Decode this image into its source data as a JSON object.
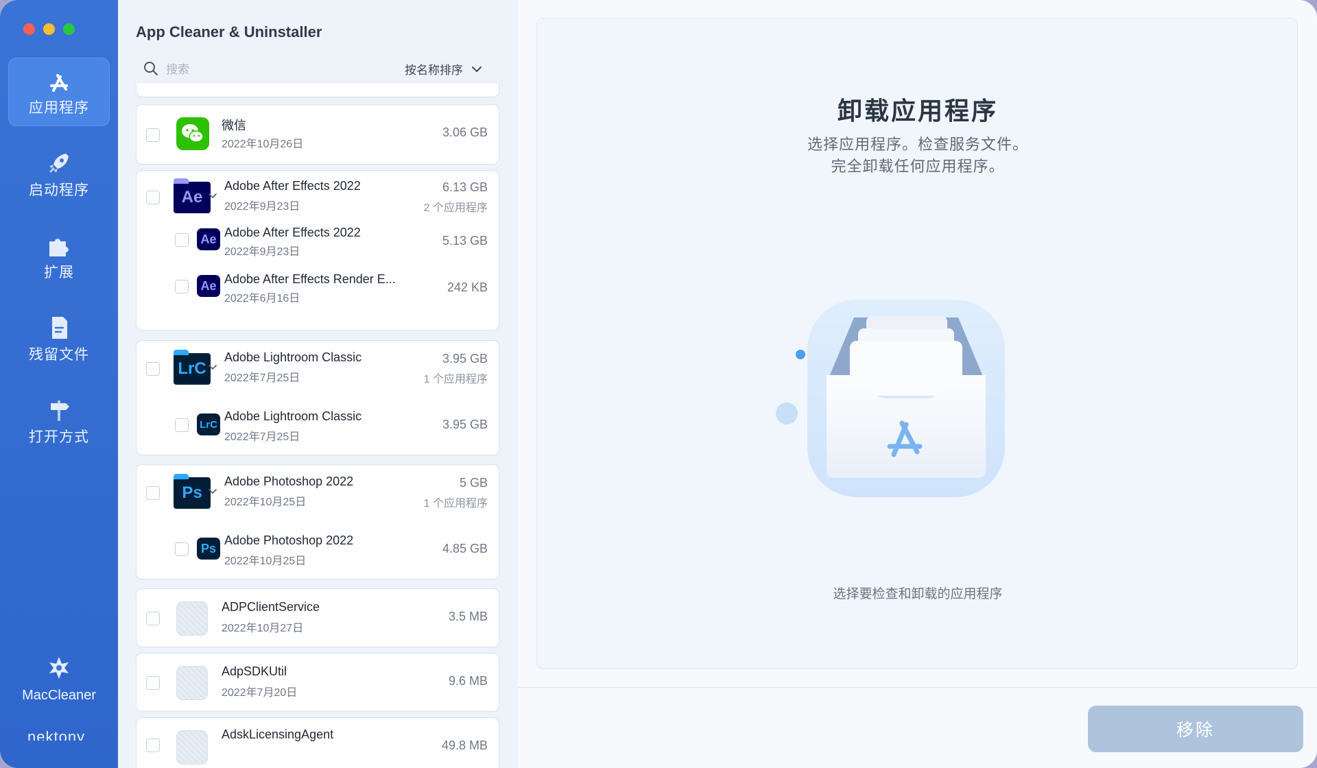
{
  "app": {
    "title": "App Cleaner & Uninstaller"
  },
  "sidebar": {
    "items": [
      {
        "label": "应用程序",
        "icon": "app-store-icon"
      },
      {
        "label": "启动程序",
        "icon": "rocket-icon"
      },
      {
        "label": "扩展",
        "icon": "puzzle-icon"
      },
      {
        "label": "残留文件",
        "icon": "document-icon"
      },
      {
        "label": "打开方式",
        "icon": "signpost-icon"
      }
    ],
    "bottom": {
      "label": "MacCleaner",
      "icon": "maccleaner-icon"
    },
    "brand": "nektony"
  },
  "search": {
    "placeholder": "搜索",
    "value": ""
  },
  "sort": {
    "label": "按名称排序"
  },
  "apps": [
    {
      "name": "微信",
      "date": "2022年10月26日",
      "size": "3.06 GB"
    },
    {
      "name": "Adobe After Effects 2022",
      "date": "2022年9月23日",
      "size": "6.13 GB",
      "count": "2 个应用程序",
      "children": [
        {
          "name": "Adobe After Effects 2022",
          "date": "2022年9月23日",
          "size": "5.13 GB"
        },
        {
          "name": "Adobe After Effects Render E...",
          "date": "2022年6月16日",
          "size": "242 KB"
        }
      ]
    },
    {
      "name": "Adobe Lightroom Classic",
      "date": "2022年7月25日",
      "size": "3.95 GB",
      "count": "1 个应用程序",
      "children": [
        {
          "name": "Adobe Lightroom Classic",
          "date": "2022年7月25日",
          "size": "3.95 GB"
        }
      ]
    },
    {
      "name": "Adobe Photoshop 2022",
      "date": "2022年10月25日",
      "size": "5 GB",
      "count": "1 个应用程序",
      "children": [
        {
          "name": "Adobe Photoshop 2022",
          "date": "2022年10月25日",
          "size": "4.85 GB"
        }
      ]
    },
    {
      "name": "ADPClientService",
      "date": "2022年10月27日",
      "size": "3.5 MB"
    },
    {
      "name": "AdpSDKUtil",
      "date": "2022年7月20日",
      "size": "9.6 MB"
    },
    {
      "name": "AdskLicensingAgent",
      "date": "",
      "size": "49.8 MB"
    }
  ],
  "icons": {
    "ae": "Ae",
    "lrc": "LrC",
    "ps": "Ps"
  },
  "detail": {
    "title": "卸载应用程序",
    "subtitle_line1": "选择应用程序。检查服务文件。",
    "subtitle_line2": "完全卸载任何应用程序。",
    "hint": "选择要检查和卸载的应用程序"
  },
  "actions": {
    "remove": "移除"
  },
  "colors": {
    "sidebar": "#3a73d6",
    "ae_bg": "#00005b",
    "ae_fg": "#9999ff",
    "lrc_bg": "#001e36",
    "lrc_fg": "#31a8ff",
    "ps_bg": "#001e36",
    "ps_fg": "#31a8ff",
    "wechat": "#2dc100",
    "remove_btn": "#aec4dd"
  }
}
